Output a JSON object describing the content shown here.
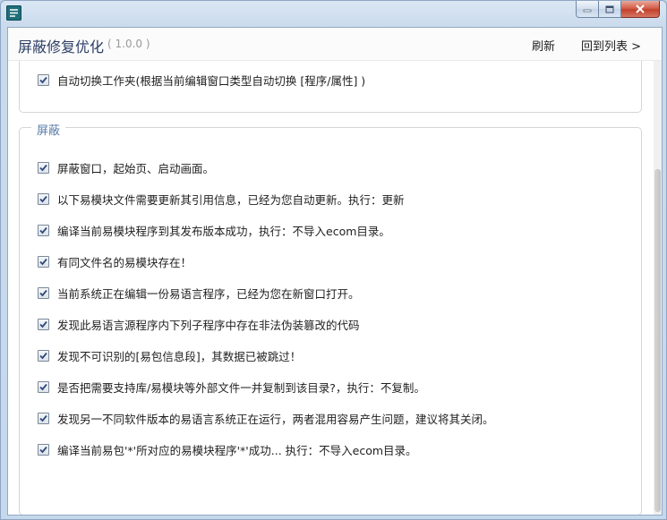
{
  "window": {
    "controls": [
      "minimize-icon",
      "maximize-icon",
      "close-icon"
    ]
  },
  "header": {
    "title": "屏蔽修复优化",
    "version": "( 1.0.0 )",
    "refresh_label": "刷新",
    "back_label": "回到列表 >"
  },
  "top_group": {
    "items": [
      {
        "label": "自动切换工作夹(根据当前编辑窗口类型自动切换 [程序/属性] )",
        "checked": true
      }
    ]
  },
  "shield_group": {
    "legend": "屏蔽",
    "items": [
      {
        "label": "屏蔽窗口，起始页、启动画面。",
        "checked": true
      },
      {
        "label": "以下易模块文件需要更新其引用信息，已经为您自动更新。执行：更新",
        "checked": true
      },
      {
        "label": "编译当前易模块程序到其发布版本成功，执行：不导入ecom目录。",
        "checked": true
      },
      {
        "label": "有同文件名的易模块存在！",
        "checked": true
      },
      {
        "label": "当前系统正在编辑一份易语言程序，已经为您在新窗口打开。",
        "checked": true
      },
      {
        "label": "发现此易语言源程序内下列子程序中存在非法伪装篡改的代码",
        "checked": true
      },
      {
        "label": "发现不可识别的[易包信息段]，其数据已被跳过！",
        "checked": true
      },
      {
        "label": "是否把需要支持库/易模块等外部文件一并复制到该目录?，执行：不复制。",
        "checked": true
      },
      {
        "label": "发现另一不同软件版本的易语言系统正在运行，两者混用容易产生问题，建议将其关闭。",
        "checked": true
      },
      {
        "label": "编译当前易包'*'所对应的易模块程序'*'成功... 执行：不导入ecom目录。",
        "checked": true
      }
    ]
  },
  "colors": {
    "title": "#2c3f66",
    "legend": "#5b7da8",
    "window_frame": "#c9daec",
    "close_button": "#c2412b"
  }
}
